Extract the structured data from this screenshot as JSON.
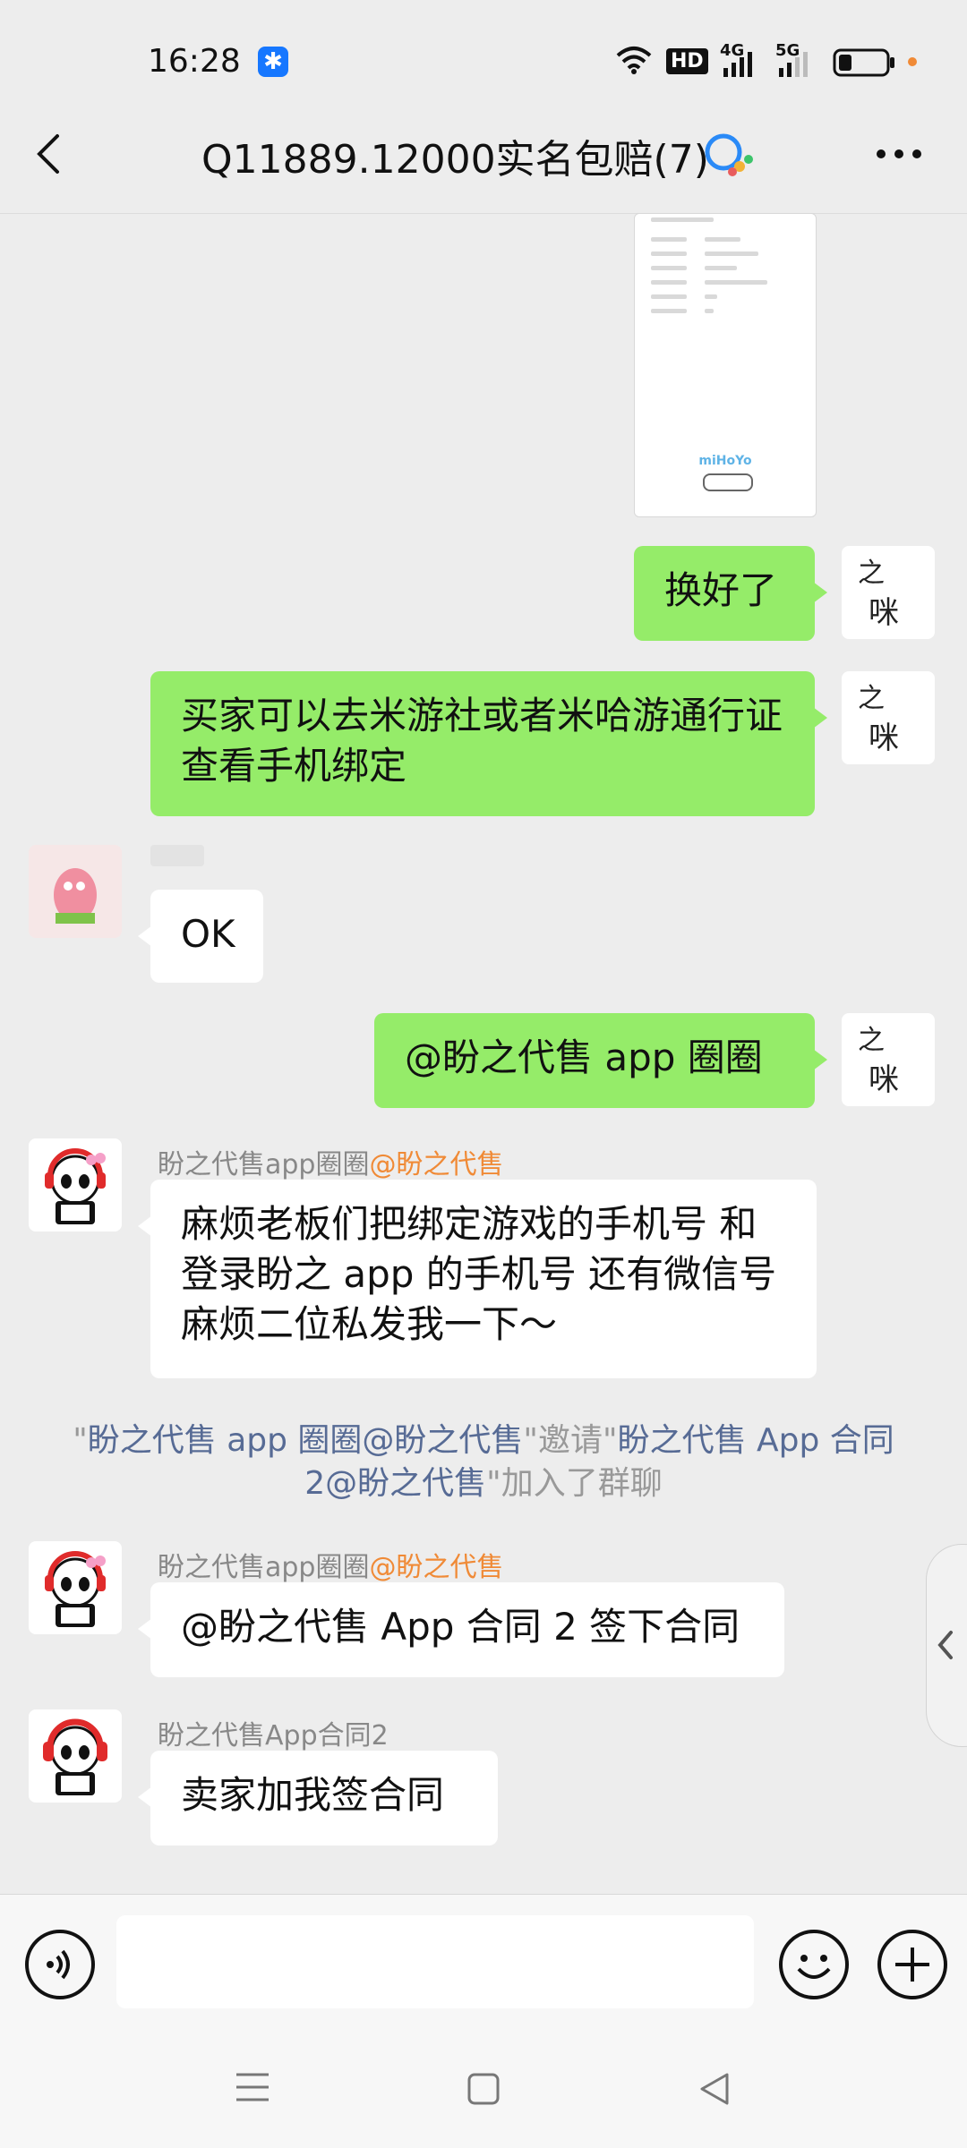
{
  "status_bar": {
    "time": "16:28",
    "network_labels": [
      "HD",
      "4G",
      "5G"
    ]
  },
  "header": {
    "title": "Q11889.12000实名包赔(7)"
  },
  "shared_image": {
    "brand": "miHoYo"
  },
  "messages": [
    {
      "side": "right",
      "text": "换好了"
    },
    {
      "side": "right",
      "text": "买家可以去米游社或者米哈游通行证查看手机绑定"
    },
    {
      "side": "left",
      "text": "OK"
    },
    {
      "side": "right",
      "text": "@盼之代售 app 圈圈"
    },
    {
      "side": "left",
      "sender": "盼之代售app圈圈",
      "sender_mention": "@盼之代售",
      "text": "麻烦老板们把绑定游戏的手机号 和登录盼之 app 的手机号 还有微信号麻烦二位私发我一下～"
    },
    {
      "side": "left",
      "sender": "盼之代售app圈圈",
      "sender_mention": "@盼之代售",
      "text": "@盼之代售 App 合同 2 签下合同"
    },
    {
      "side": "left",
      "sender": "盼之代售App合同2",
      "text": "卖家加我签合同"
    }
  ],
  "system_message": {
    "quote1": "\"",
    "inviter": "盼之代售 app 圈圈@盼之代售",
    "quote2": "\"",
    "verb": "邀请",
    "quote3": "\"",
    "invitee": "盼之代售 App 合同 2@盼之代售",
    "quote4": "\"",
    "suffix": "加入了群聊"
  },
  "colors": {
    "green_bubble": "#95ec69",
    "mention": "#f08a36",
    "link": "#576b95",
    "background": "#ededed"
  }
}
